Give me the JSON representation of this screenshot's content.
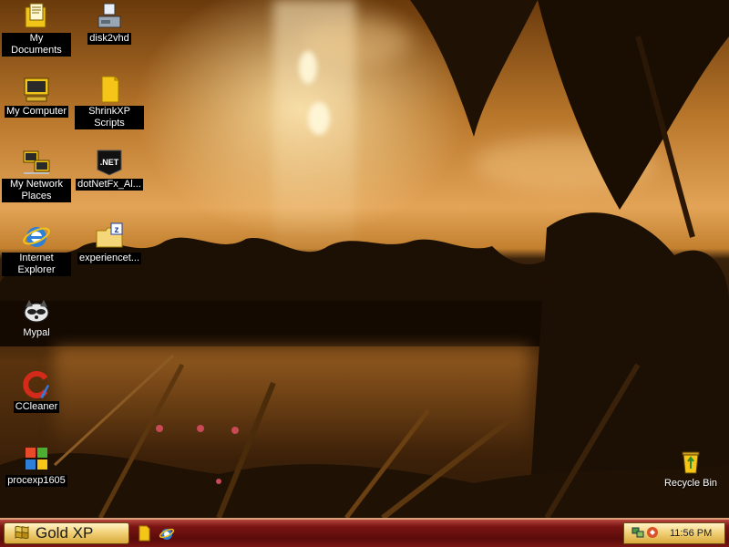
{
  "desktop": {
    "icons": [
      {
        "name": "my-documents-icon",
        "label": "My Documents"
      },
      {
        "name": "disk2vhd-icon",
        "label": "disk2vhd"
      },
      {
        "name": "my-computer-icon",
        "label": "My Computer"
      },
      {
        "name": "shrinkxp-scripts-icon",
        "label": "ShrinkXP Scripts"
      },
      {
        "name": "my-network-places-icon",
        "label": "My Network Places"
      },
      {
        "name": "dotnetfx-icon",
        "label": "dotNetFx_Al...",
        "badge": ".NET"
      },
      {
        "name": "internet-explorer-icon",
        "label": "Internet Explorer"
      },
      {
        "name": "experiencet-icon",
        "label": "experiencet..."
      },
      {
        "name": "mypal-icon",
        "label": "Mypal"
      },
      {
        "name": "ccleaner-icon",
        "label": "CCleaner"
      },
      {
        "name": "procexp-icon",
        "label": "procexp1605"
      },
      {
        "name": "recycle-bin-icon",
        "label": "Recycle Bin"
      }
    ]
  },
  "taskbar": {
    "start_label": "Gold XP",
    "clock": "11:56 PM"
  },
  "colors": {
    "taskbar": "#7a1513",
    "start_button": "#f2d27a",
    "label_bg": "#000000"
  }
}
